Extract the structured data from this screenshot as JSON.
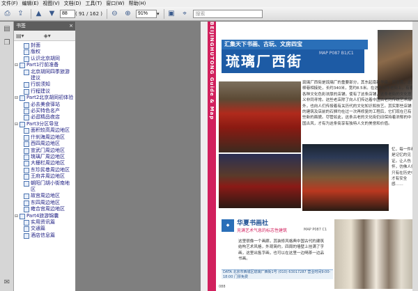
{
  "menu": [
    "文件(F)",
    "编辑(E)",
    "视图(V)",
    "文档(D)",
    "工具(T)",
    "窗口(W)",
    "帮助(H)"
  ],
  "toolbar": {
    "page_current": "88",
    "page_total": "( 91 / 162 )",
    "zoom": "91%",
    "search_placeholder": "搜索",
    "icons": [
      "print-icon",
      "share-icon",
      "prev-icon",
      "next-icon",
      "zoom-in-icon",
      "save-icon",
      "select-icon"
    ]
  },
  "panel": {
    "title": "书签",
    "close": "×"
  },
  "bookmarks": [
    {
      "label": "封面",
      "level": 1,
      "toggle": ""
    },
    {
      "label": "版权",
      "level": 1,
      "toggle": ""
    },
    {
      "label": "认识北京胡同",
      "level": 1,
      "toggle": ""
    },
    {
      "label": "Part1行前准备",
      "level": 0,
      "toggle": "⊟"
    },
    {
      "label": "北京胡同四季旅游建议",
      "level": 1,
      "toggle": "",
      "wrap": true
    },
    {
      "label": "行前须知",
      "level": 1,
      "toggle": ""
    },
    {
      "label": "行程建议",
      "level": 1,
      "toggle": ""
    },
    {
      "label": "Part2北京胡同初体验",
      "level": 0,
      "toggle": "⊟"
    },
    {
      "label": "必去美食驿站",
      "level": 1,
      "toggle": ""
    },
    {
      "label": "必买特色名产",
      "level": 1,
      "toggle": ""
    },
    {
      "label": "必逛精品夜店",
      "level": 1,
      "toggle": ""
    },
    {
      "label": "Part3分区导览",
      "level": 0,
      "toggle": "⊟"
    },
    {
      "label": "面积较高周边地区",
      "level": 1,
      "toggle": ""
    },
    {
      "label": "什刹海周边地区",
      "level": 1,
      "toggle": ""
    },
    {
      "label": "西四周边地区",
      "level": 1,
      "toggle": ""
    },
    {
      "label": "宣武门周边地区",
      "level": 1,
      "toggle": ""
    },
    {
      "label": "琉璃厂周边地区",
      "level": 1,
      "toggle": ""
    },
    {
      "label": "大栅栏周边地区",
      "level": 1,
      "toggle": ""
    },
    {
      "label": "东珍民巷周边地区",
      "level": 1,
      "toggle": ""
    },
    {
      "label": "王府井周边地区",
      "level": 1,
      "toggle": ""
    },
    {
      "label": "朝阳门胡小街南地区",
      "level": 1,
      "toggle": "",
      "wrap": true
    },
    {
      "label": "故宫周边地区",
      "level": 1,
      "toggle": ""
    },
    {
      "label": "东四周边地区",
      "level": 1,
      "toggle": ""
    },
    {
      "label": "雍合宫周边地区",
      "level": 1,
      "toggle": ""
    },
    {
      "label": "Part4旅游锦囊",
      "level": 0,
      "toggle": "⊟"
    },
    {
      "label": "实用资讯篇",
      "level": 1,
      "toggle": ""
    },
    {
      "label": "交通篇",
      "level": 1,
      "toggle": ""
    },
    {
      "label": "酒店信息篇",
      "level": 1,
      "toggle": ""
    }
  ],
  "page": {
    "spine": "BEIJINGHUTONG Guide & Map",
    "band": "汇集天下书画、古玩、文房四宝",
    "title": "琉璃厂西街",
    "mapref": "MAP P087 B1/C1",
    "body1": "琉璃厂西街是琉璃厂的重要部分，其东起南新华街，西至南，北柳巷相接处，长约340米，宽约8.5米。在这条百年老街上，有着各种文化色彩浓厚的店铺，使有了这条店铺，这条老街的文化意义非同寻常。这些老店除了向人们传达着中国古老的传统艺术品外，也向人们传授着有关历代的文化知识和技艺。其实那些店铺的建筑及店前的石狮均在过一次再修复的工程后，它们现在已有些新的面貌。尽管如此，这条古老的文化街仍旧保持着浓郁的中国古风，才有为这条街享有独特人文的美誉和价值。",
    "body1b": "忆，每一件都是记忆的见证。让人伤怀，仿佛人们只有在历史中才有安全感……",
    "sub_title": "华夏书画社",
    "sub_sub": "充满艺术气息的标志性建筑",
    "sub_ref": "MAP P087 C1",
    "body2": "这里很像一个画廊，其装修风格典中国古代的建筑结构艺术风格，外观简约，四周的墙壁上挂满了字画，这里出售字画，也可以在这里一边喝茶一边品书画。",
    "data": "DATA  北京市西城区琉璃厂西街1号  (010) 63017287  营业时间9:00-18:00  门票免费",
    "pagenum": "088"
  }
}
